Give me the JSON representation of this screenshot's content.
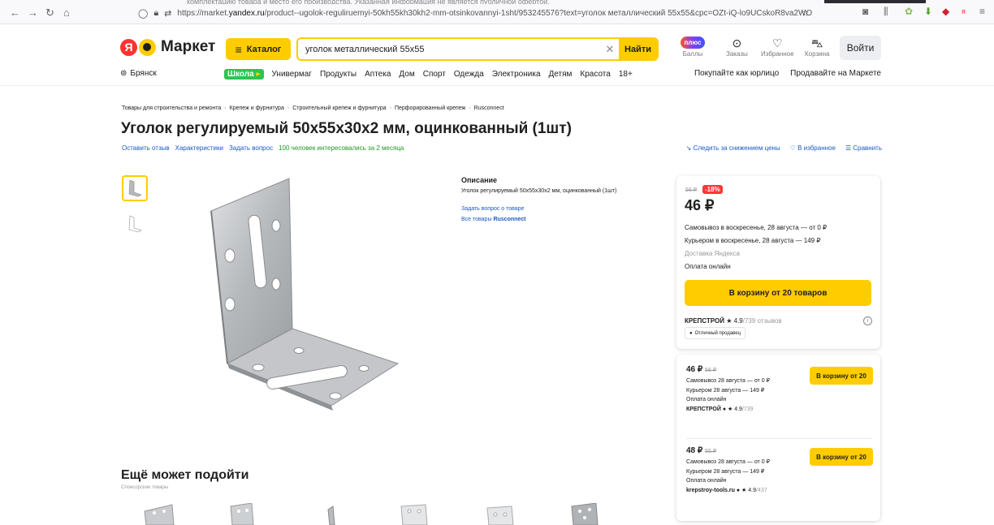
{
  "browser": {
    "notice": "комплектацию товара и место его производства. Указанная информация не является публичной офертой.",
    "url_prefix": "https://market.",
    "url_domain": "yandex.ru",
    "url_rest": "/product--ugolok-reguliruemyi-50kh55kh30kh2-mm-otsinkovannyi-1sht/953245576?text=уголок металлический 55x55&cpc=OZt-iQ-lo9UCskoR8va2WOvOOVF"
  },
  "header": {
    "logo_ya": "Я",
    "logo_text": "Маркет",
    "catalog": "Каталог",
    "search_value": "уголок металлический 55x55",
    "find": "Найти",
    "plus": "плюс",
    "points": "Баллы",
    "orders": "Заказы",
    "favorites": "Избранное",
    "cart": "Корзина",
    "login": "Войти",
    "city": "Брянск",
    "school": "Школа",
    "menu": [
      "Универмаг",
      "Продукты",
      "Аптека",
      "Дом",
      "Спорт",
      "Одежда",
      "Электроника",
      "Детям",
      "Красота",
      "18+"
    ],
    "business": "Покупайте как юрлицо",
    "sell": "Продавайте на Маркете"
  },
  "product": {
    "breadcrumbs": [
      "Товары для строительства и ремонта",
      "Крепеж и фурнитура",
      "Строительный крепеж и фурнитура",
      "Перфорированный крепеж",
      "Rusconnect"
    ],
    "title": "Уголок регулируемый 50х55х30х2 мм, оцинкованный (1шт)",
    "review": "Оставить отзыв",
    "specs": "Характеристики",
    "ask": "Задать вопрос",
    "interest": "100 человек интересовались за 2 месяца",
    "track": "Следить за снижением цены",
    "fav": "В избранное",
    "compare": "Сравнить",
    "desc_title": "Описание",
    "desc_text": "Уголок регулируемый 50х55х30х2 мм, оцинкованный (1шт)",
    "ask_product": "Задать вопрос о товаре",
    "all_goods": "Все товары",
    "brand": "Rusconnect"
  },
  "offer": {
    "old_price": "56 ₽",
    "discount": "-18%",
    "price": "46 ₽",
    "pickup": "Самовывоз в воскресенье, 28 августа — от 0 ₽",
    "courier": "Курьером в воскресенье, 28 августа — 149 ₽",
    "delivery": "Доставка Яндекса",
    "payment": "Оплата онлайн",
    "cart_btn": "В корзину от 20 товаров",
    "seller": "КРЕПСТРОЙ",
    "rating": "★ 4.9",
    "reviews": "/739 отзывов",
    "badge": "Отличный продавец"
  },
  "other_offers": [
    {
      "price": "46 ₽",
      "old": "56 ₽",
      "pickup": "Самовывоз 28 августа — от 0 ₽",
      "courier": "Курьером 28 августа — 149 ₽",
      "payment": "Оплата онлайн",
      "seller": "КРЕПСТРОЙ",
      "rating": "★ 4.9",
      "reviews": "/739",
      "btn": "В корзину от 20"
    },
    {
      "price": "48 ₽",
      "old": "55 ₽",
      "pickup": "Самовывоз 28 августа — от 0 ₽",
      "courier": "Курьером 28 августа — 149 ₽",
      "payment": "Оплата онлайн",
      "seller": "krepstroy-tools.ru",
      "rating": "★ 4.9",
      "reviews": "/437",
      "btn": "В корзину от 20"
    }
  ],
  "more": {
    "title": "Ещё может подойти",
    "sponsored": "Спонсорские товары"
  }
}
